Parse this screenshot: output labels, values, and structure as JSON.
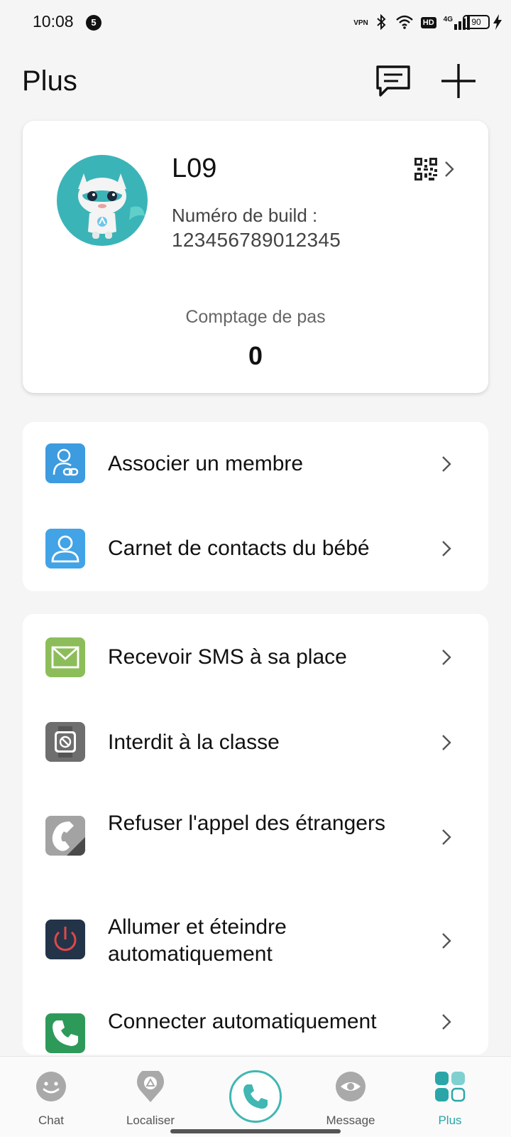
{
  "status_bar": {
    "time": "10:08",
    "notification_count": "5",
    "vpn": "VPN",
    "hd": "HD",
    "network": "4G",
    "battery": "90"
  },
  "header": {
    "title": "Plus"
  },
  "device": {
    "name": "L09",
    "build_label": "Numéro de build :",
    "build_number": "123456789012345",
    "steps_label": "Comptage de pas",
    "steps_value": "0"
  },
  "menu_group_1": [
    {
      "label": "Associer un membre",
      "icon": "link-member-icon"
    },
    {
      "label": "Carnet de contacts du bébé",
      "icon": "contacts-icon"
    }
  ],
  "menu_group_2": [
    {
      "label": "Recevoir SMS à sa place",
      "icon": "envelope-icon"
    },
    {
      "label": "Interdit à la classe",
      "icon": "watch-block-icon"
    },
    {
      "label": "Refuser l'appel des étrangers",
      "icon": "phone-reject-icon"
    },
    {
      "label": "Allumer et éteindre automatiquement",
      "icon": "power-icon"
    },
    {
      "label": "Connecter automatiquement",
      "icon": "phone-icon"
    }
  ],
  "bottom_nav": [
    {
      "label": "Chat",
      "icon": "smiley-chat-icon"
    },
    {
      "label": "Localiser",
      "icon": "location-pin-icon"
    },
    {
      "label": "Message",
      "icon": "eye-icon"
    },
    {
      "label": "Plus",
      "icon": "grid-icon",
      "active": true
    }
  ],
  "colors": {
    "accent": "#2aa6a8",
    "avatar_bg": "#3bb4b8",
    "text": "#111111",
    "background": "#f5f5f5"
  }
}
